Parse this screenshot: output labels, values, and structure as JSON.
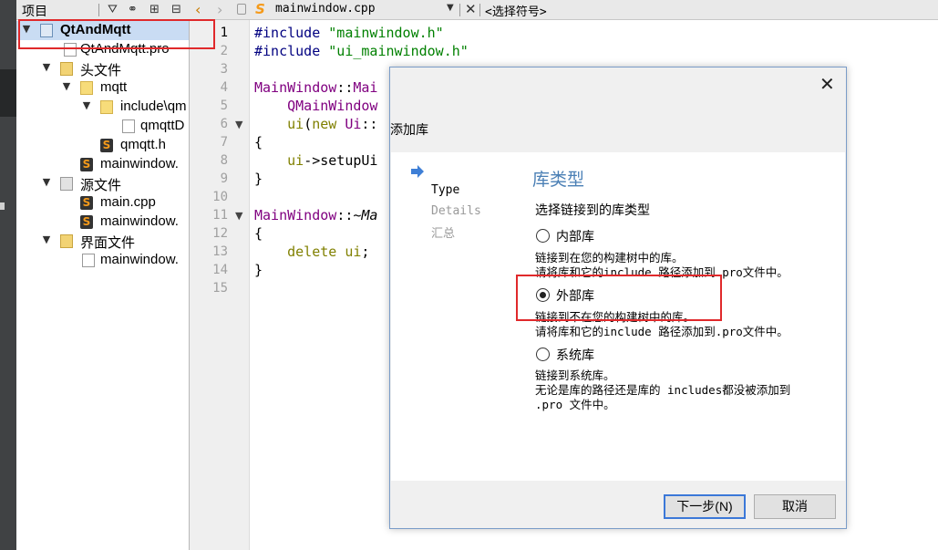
{
  "project_panel": {
    "title": "项目",
    "tree": [
      {
        "label": "QtAndMqtt",
        "kind": "project",
        "expanded": true
      },
      {
        "label": "QtAndMqtt.pro",
        "kind": "pro-file"
      },
      {
        "label": "头文件",
        "kind": "headers-folder",
        "expanded": true
      },
      {
        "label": "mqtt",
        "kind": "folder",
        "expanded": true
      },
      {
        "label": "include\\qm",
        "kind": "folder",
        "expanded": true
      },
      {
        "label": "qmqttD",
        "kind": "file"
      },
      {
        "label": "qmqtt.h",
        "kind": "header"
      },
      {
        "label": "mainwindow.",
        "kind": "header"
      },
      {
        "label": "源文件",
        "kind": "sources-folder",
        "expanded": true
      },
      {
        "label": "main.cpp",
        "kind": "source"
      },
      {
        "label": "mainwindow.",
        "kind": "source"
      },
      {
        "label": "界面文件",
        "kind": "forms-folder",
        "expanded": true
      },
      {
        "label": "mainwindow.",
        "kind": "ui-file"
      }
    ]
  },
  "editor": {
    "file_name": "mainwindow.cpp",
    "symbol": "<选择符号>",
    "current_line": 1,
    "line_numbers": [
      "1",
      "2",
      "3",
      "4",
      "5",
      "6",
      "7",
      "8",
      "9",
      "10",
      "11",
      "12",
      "13",
      "14",
      "15"
    ],
    "lines": [
      "#include \"mainwindow.h\"",
      "#include \"ui_mainwindow.h\"",
      "",
      "MainWindow::Mai",
      "    QMainWindow",
      "    ui(new Ui::",
      "{",
      "    ui->setupUi",
      "}",
      "",
      "MainWindow::~Ma",
      "{",
      "    delete ui;",
      "}",
      ""
    ]
  },
  "dialog": {
    "title": "添加库",
    "steps": [
      {
        "label": "Type",
        "active": true
      },
      {
        "label": "Details",
        "active": false
      },
      {
        "label": "汇总",
        "active": false
      }
    ],
    "heading": "库类型",
    "subtitle": "选择链接到的库类型",
    "options": [
      {
        "label": "内部库",
        "selected": false,
        "desc": "链接到在您的构建树中的库。\n请将库和它的include 路径添加到.pro文件中。"
      },
      {
        "label": "外部库",
        "selected": true,
        "desc": "链接到不在您的构建树中的库。\n请将库和它的include 路径添加到.pro文件中。"
      },
      {
        "label": "系统库",
        "selected": false,
        "desc": "链接到系统库。\n无论是库的路径还是库的 includes都没被添加到\n.pro 文件中。"
      }
    ],
    "next_button": "下一步(N)",
    "cancel_button": "取消"
  },
  "colors": {
    "highlight_box": "#e0292b",
    "heading": "#4a7fb5",
    "default_button_border": "#3b78d8",
    "selection": "#c9dcf3"
  }
}
